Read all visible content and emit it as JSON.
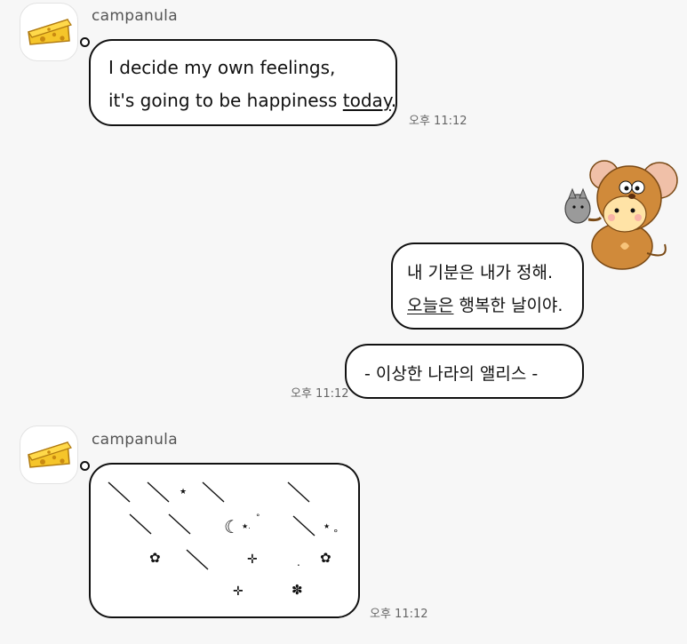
{
  "messages": [
    {
      "sender": "campanula",
      "line1": "I decide my own feelings,",
      "line2_pre": "it's going to be happiness ",
      "line2_under": "today",
      "line2_post": ".",
      "time": "오후 11:12"
    },
    {
      "line1": "내 기분은 내가 정해.",
      "line2_under": "오늘은",
      "line2_post": " 행복한 날이야.",
      "quote": "- 이상한 나라의 앨리스 -",
      "time": "오후 11:12"
    },
    {
      "sender": "campanula",
      "time": "오후 11:12"
    }
  ],
  "icons": {
    "avatar": "cheese-icon",
    "sticker": "mouse-costume-sticker-icon",
    "decor": [
      "slash",
      "star",
      "moon",
      "sparkle",
      "flower"
    ]
  },
  "colors": {
    "background": "#f7f7f7",
    "bubble": "#ffffff",
    "outline": "#111111",
    "cheese": "#f5c52a"
  }
}
